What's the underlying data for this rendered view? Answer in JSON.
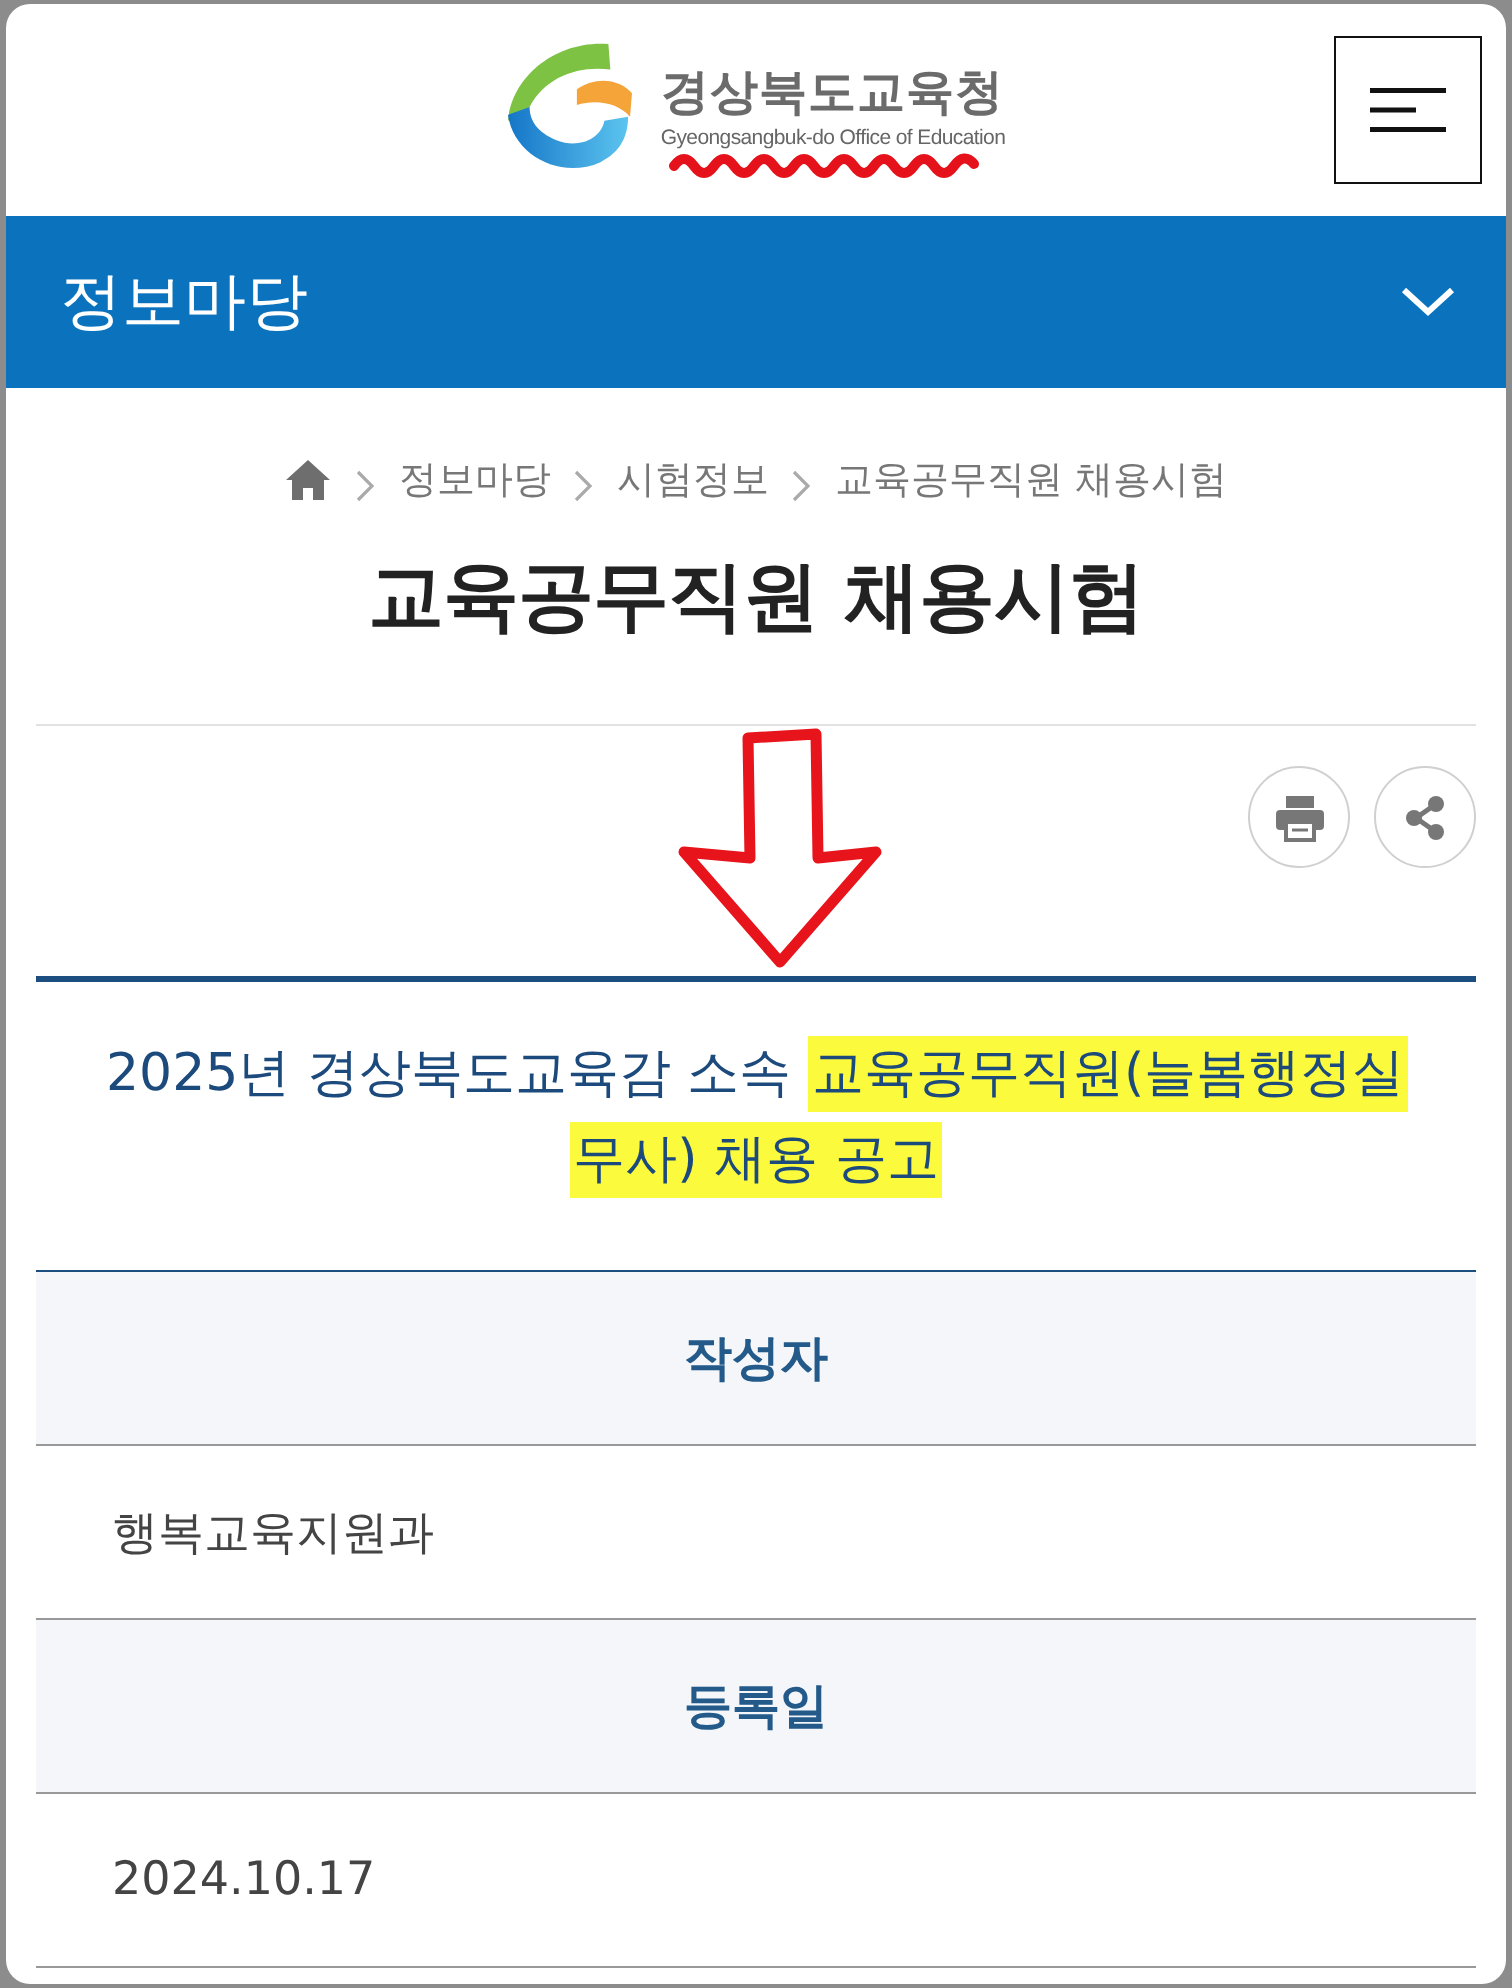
{
  "header": {
    "logo_title": "경상북도교육청",
    "logo_subtitle": "Gyeongsangbuk-do Office of Education"
  },
  "section_bar": {
    "title": "정보마당",
    "expanded": false
  },
  "breadcrumb": [
    "정보마당",
    "시험정보",
    "교육공무직원 채용시험"
  ],
  "page_title": "교육공무직원 채용시험",
  "post": {
    "title_segments": [
      {
        "text": "2025년 경상북도교육감 소속 ",
        "highlighted": false
      },
      {
        "text": "교육공무직원(늘봄행정실무사) 채용 공고 ",
        "highlighted": true
      }
    ],
    "fields": [
      {
        "label": "작성자",
        "value": "행복교육지원과"
      },
      {
        "label": "등록일",
        "value": "2024.10.17"
      }
    ]
  },
  "annotations": {
    "squiggle_under_logo": true,
    "arrow_above_post": true
  }
}
